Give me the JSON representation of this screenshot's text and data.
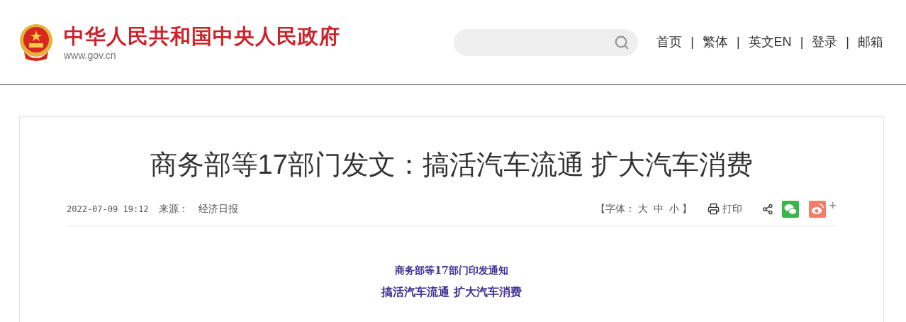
{
  "site": {
    "title": "中华人民共和国中央人民政府",
    "url": "www.gov.cn"
  },
  "nav": {
    "separator": "|",
    "items": [
      "首页",
      "繁体",
      "英文EN",
      "登录",
      "邮箱"
    ]
  },
  "article": {
    "title": "商务部等17部门发文：搞活汽车流通 扩大汽车消费",
    "date": "2022-07-09 19:12",
    "source_label": "来源：",
    "source": "经济日报",
    "font_size": {
      "open": "【字体：",
      "options": [
        "大",
        "中",
        "小"
      ],
      "close": "】"
    },
    "print": "打印",
    "share_more": "+",
    "body": {
      "subtitle": "商务部等17部门印发通知",
      "headline": "搞活汽车流通 扩大汽车消费"
    }
  }
}
